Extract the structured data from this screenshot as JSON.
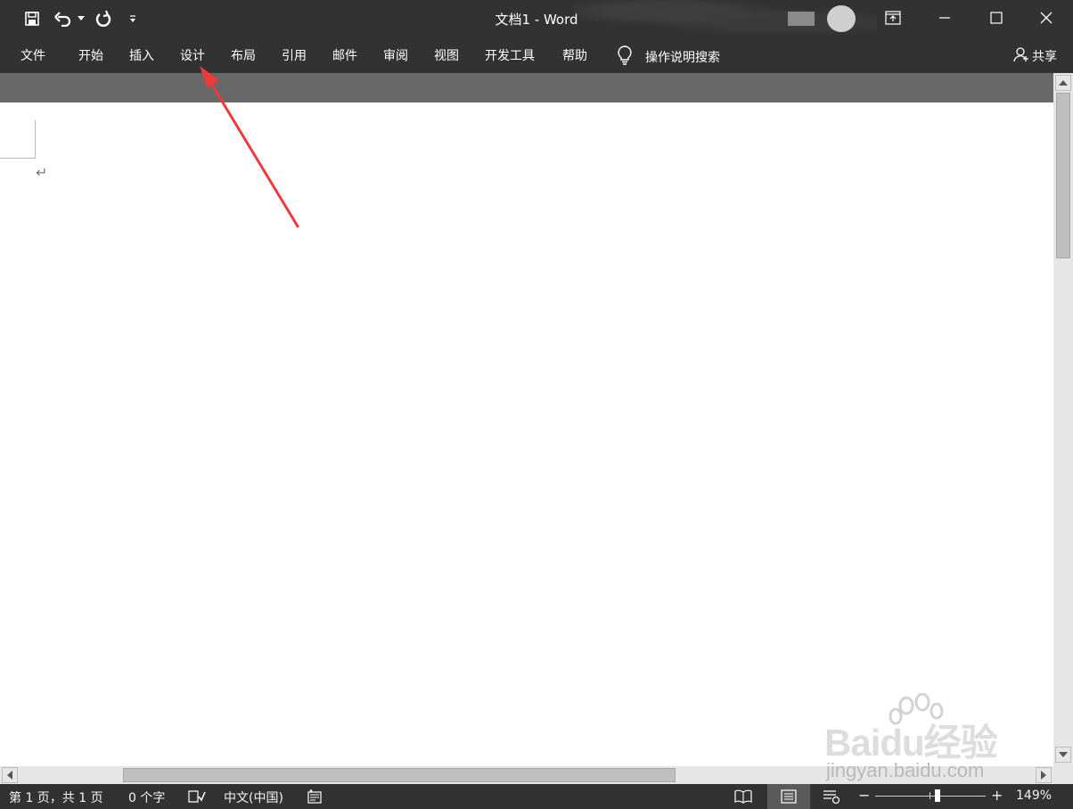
{
  "window": {
    "title": "文档1  -  Word",
    "minimize_label": "minimize",
    "maximize_label": "maximize",
    "close_label": "close"
  },
  "ribbon": {
    "tabs": [
      "文件",
      "开始",
      "插入",
      "设计",
      "布局",
      "引用",
      "邮件",
      "审阅",
      "视图",
      "开发工具",
      "帮助"
    ],
    "search_label": "操作说明搜索",
    "share_label": "共享"
  },
  "document": {
    "paragraph_mark": "↵"
  },
  "statusbar": {
    "page_info": "第 1 页，共 1 页",
    "word_count": "0 个字",
    "language": "中文(中国)",
    "zoom_minus": "−",
    "zoom_plus": "+",
    "zoom_level": "149%"
  },
  "annotation": {
    "color": "#ee3a3a",
    "points_to": "设计"
  },
  "watermark": {
    "logo": "Baidu经验",
    "url": "jingyan.baidu.com"
  }
}
